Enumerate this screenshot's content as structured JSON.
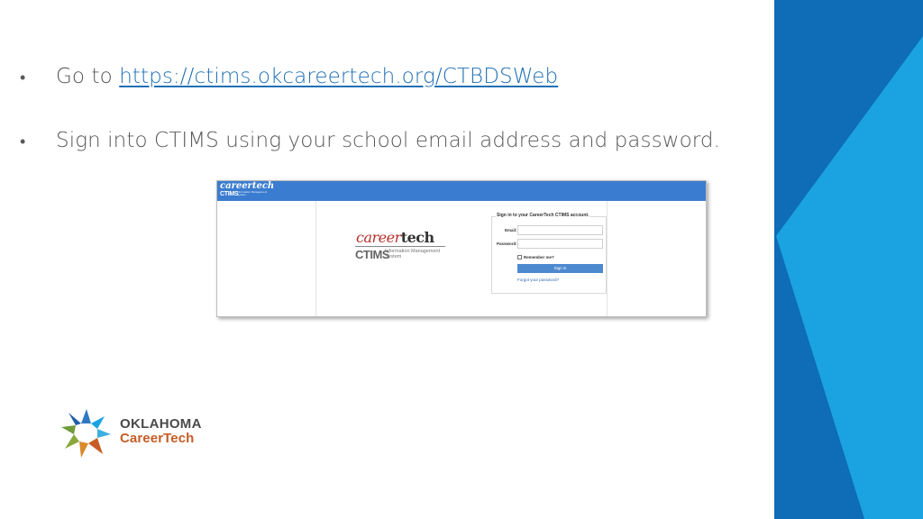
{
  "bullets": [
    {
      "marker": "•",
      "text": "Go to ",
      "link": "https://ctims.okcareertech.org/CTBDSWeb"
    },
    {
      "marker": "•",
      "text": "Sign into CTIMS using your school email address and password."
    }
  ],
  "screenshot": {
    "header": {
      "brand_career": "career",
      "brand_tech": "tech",
      "ctims": "CTIMS",
      "subtitle": "Information Management System"
    },
    "logo": {
      "career": "career",
      "tech": "tech",
      "ctims": "CTIMS",
      "subtitle": "Information Management System"
    },
    "signin": {
      "title": "Sign in to your CareerTech CTIMS account.",
      "email_label": "Email:",
      "email_value": "",
      "password_label": "Password:",
      "password_value": "",
      "remember_label": "Remember me?",
      "button_label": "Sign in",
      "forgot_label": "Forgot your password?"
    }
  },
  "footer_logo": {
    "line1": "OKLAHOMA",
    "line2": "CareerTech"
  },
  "colors": {
    "link": "#1f6fb5",
    "deco_dark": "#0f6cb6",
    "deco_light": "#1aa3e0",
    "header_blue": "#3a7ccf",
    "brand_orange": "#c65c25"
  }
}
